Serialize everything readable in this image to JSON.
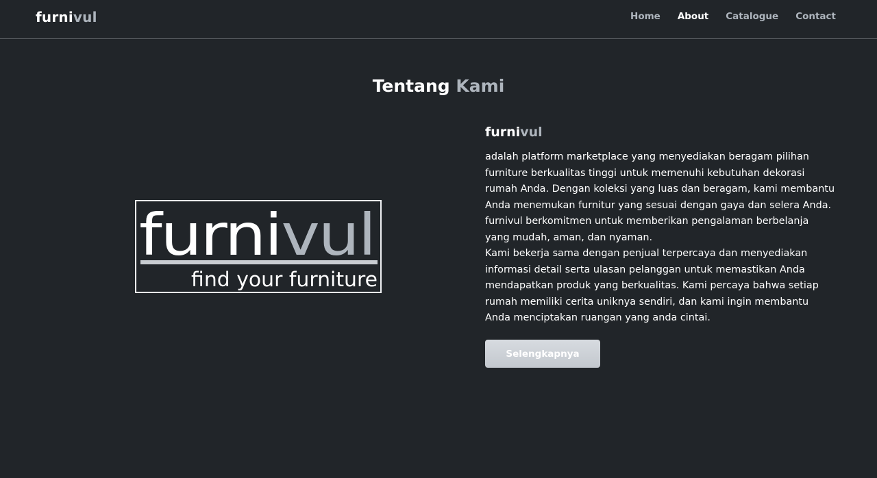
{
  "navbar": {
    "brand": {
      "main": "furni",
      "accent": "vul"
    },
    "links": [
      {
        "label": "Home",
        "active": false
      },
      {
        "label": "About",
        "active": true
      },
      {
        "label": "Catalogue",
        "active": false
      },
      {
        "label": "Contact",
        "active": false
      }
    ]
  },
  "section": {
    "title_main": "Tentang",
    "title_accent": "Kami"
  },
  "logo": {
    "word_main": "furni",
    "word_accent": "vul",
    "tagline": "find your furniture"
  },
  "about": {
    "brand_main": "furni",
    "brand_accent": "vul",
    "paragraph1": "adalah platform marketplace yang menyediakan beragam pilihan furniture berkualitas tinggi untuk memenuhi kebutuhan dekorasi rumah Anda. Dengan koleksi yang luas dan beragam, kami membantu Anda menemukan furnitur yang sesuai dengan gaya dan selera Anda. furnivul berkomitmen untuk memberikan pengalaman berbelanja yang mudah, aman, dan nyaman.",
    "paragraph2": "Kami bekerja sama dengan penjual terpercaya dan menyediakan informasi detail serta ulasan pelanggan untuk memastikan Anda mendapatkan produk yang berkualitas. Kami percaya bahwa setiap rumah memiliki cerita uniknya sendiri, dan kami ingin membantu Anda menciptakan ruangan yang anda cintai.",
    "button_label": "Selengkapnya"
  },
  "colors": {
    "background": "#212529",
    "accent": "#aeb5bd",
    "text": "#ffffff",
    "button": "#ced4da"
  }
}
